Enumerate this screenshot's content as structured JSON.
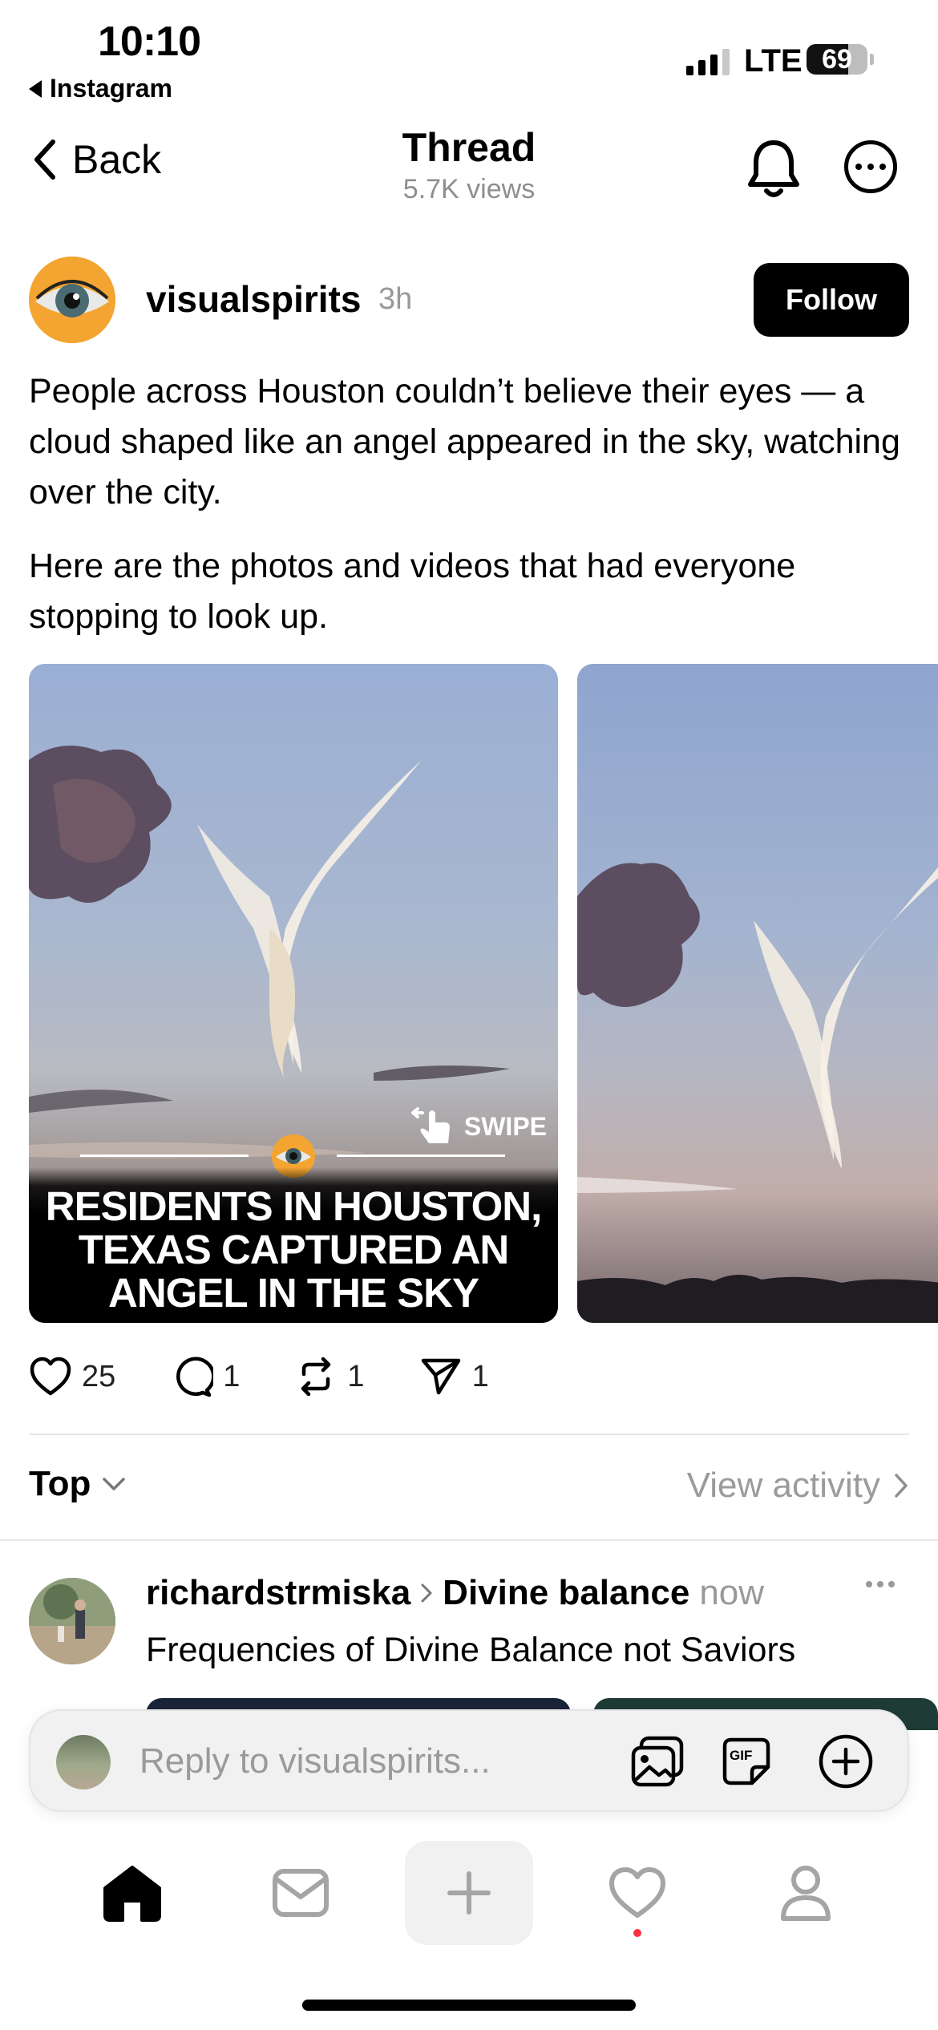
{
  "status_bar": {
    "time": "10:10",
    "back_app": "Instagram",
    "network": "LTE",
    "battery": "69",
    "battery_level": 0.69
  },
  "header": {
    "back_label": "Back",
    "title": "Thread",
    "views": "5.7K views"
  },
  "post": {
    "username": "visualspirits",
    "time": "3h",
    "follow_label": "Follow",
    "paragraph1": "People across Houston couldn’t believe their eyes — a cloud shaped like an angel appeared in the sky, watching over the city.",
    "paragraph2": "Here are the photos and videos that had everyone stopping to look up.",
    "image_headline_line1": "RESIDENTS IN HOUSTON,",
    "image_headline_line2": "TEXAS CAPTURED AN",
    "image_headline_line3": "ANGEL IN THE SKY",
    "swipe_label": "SWIPE",
    "likes": "25",
    "comments": "1",
    "reposts": "1",
    "shares": "1"
  },
  "sort": {
    "label": "Top",
    "activity_label": "View activity"
  },
  "reply": {
    "username": "richardstrmiska",
    "topic": "Divine balance",
    "time": "now",
    "text": "Frequencies of Divine Balance not Saviors"
  },
  "composer": {
    "placeholder": "Reply to visualspirits...",
    "gif_label": "GIF"
  },
  "colors": {
    "accent": "#000000",
    "secondary_text": "#8e8e8e",
    "notification_dot": "#ff3040"
  }
}
